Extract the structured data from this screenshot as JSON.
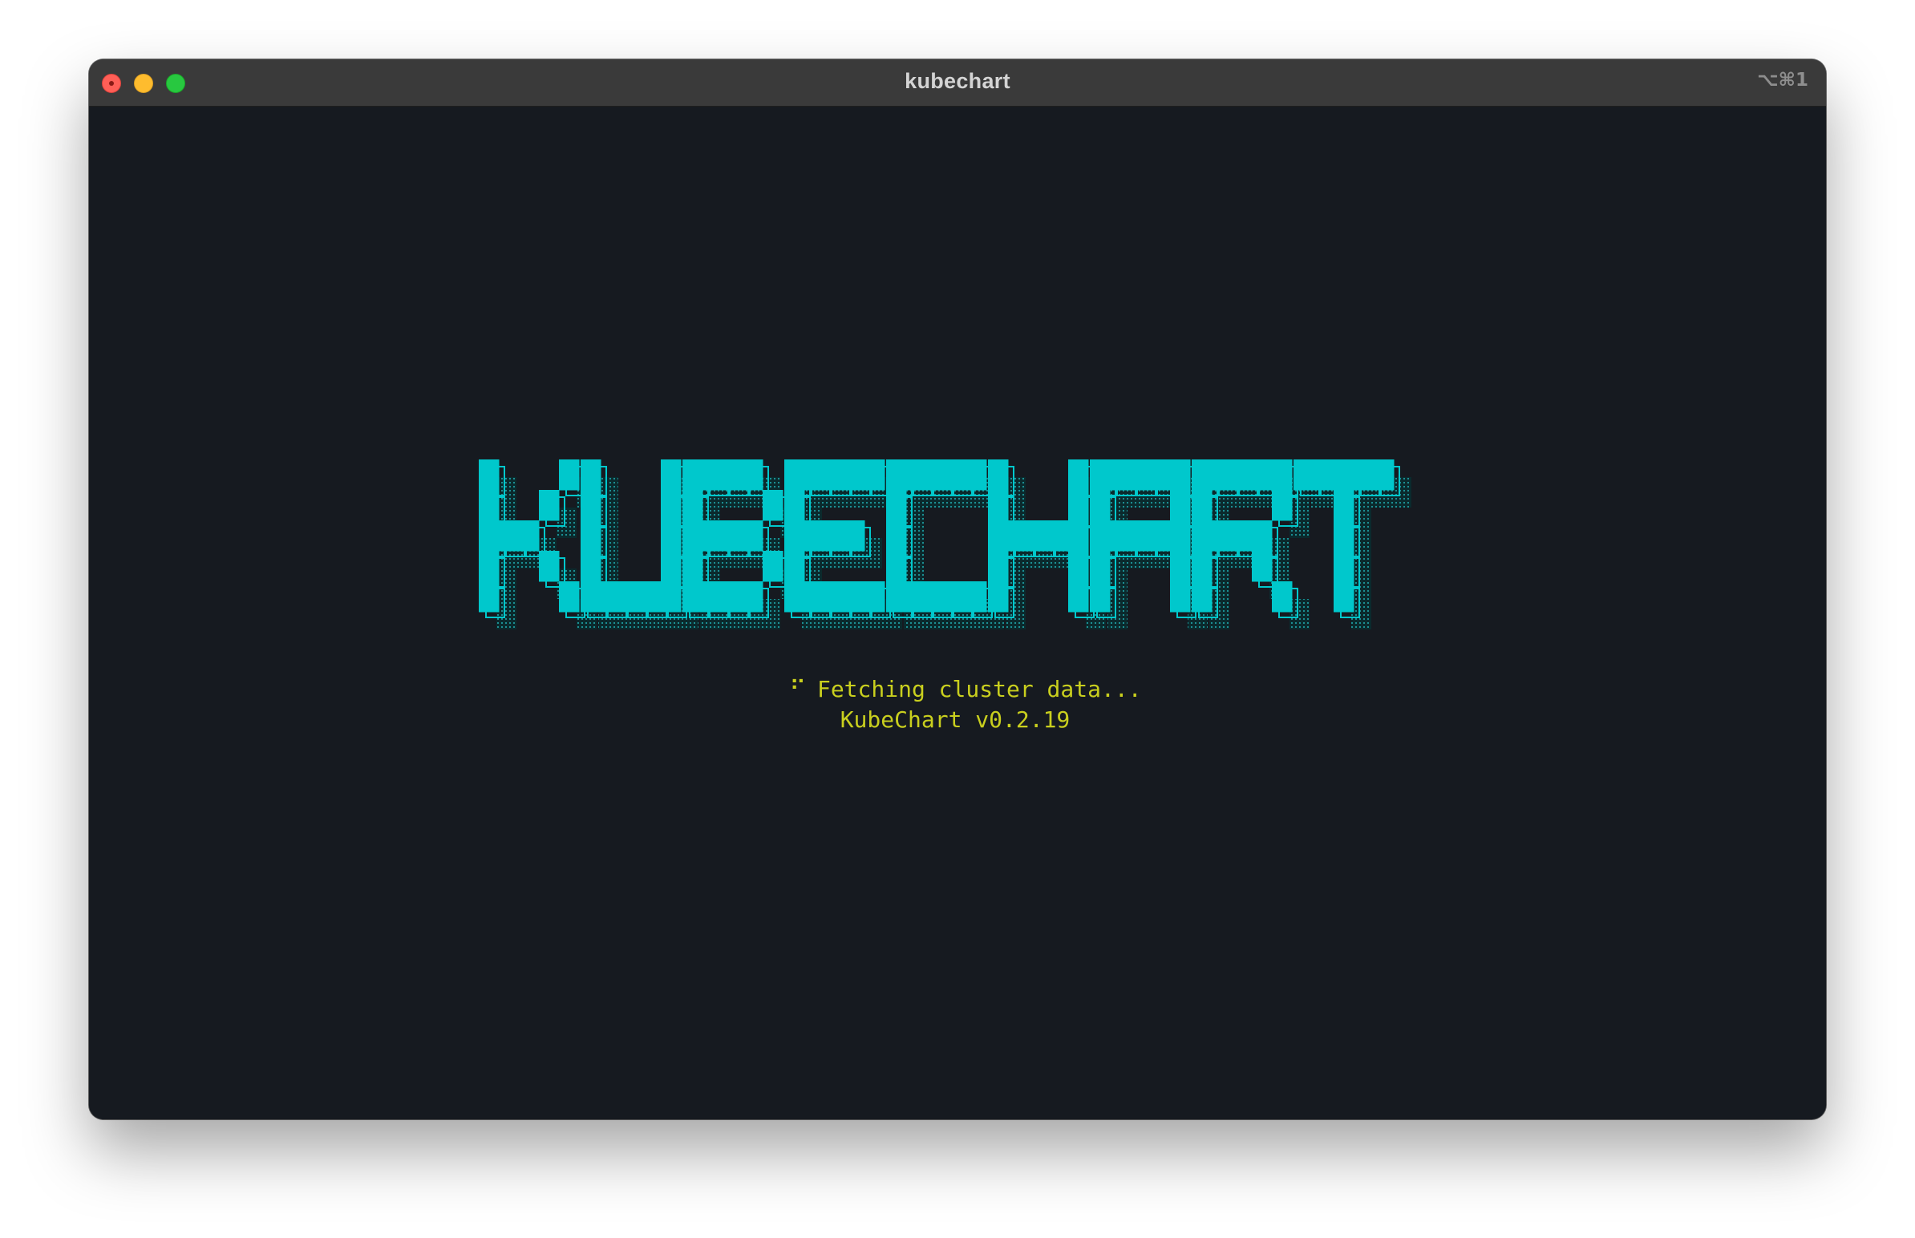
{
  "window": {
    "title": "kubechart",
    "shortcut": "⌥⌘1"
  },
  "splash": {
    "logo_text": "KUBECHART",
    "spinner": "⠋",
    "status": "Fetching cluster data...",
    "version": "KubeChart v0.2.19"
  },
  "colors": {
    "logo": "#00c8cc",
    "status_text": "#c9cf1e",
    "background": "#161a20",
    "titlebar": "#3a3a3a"
  }
}
